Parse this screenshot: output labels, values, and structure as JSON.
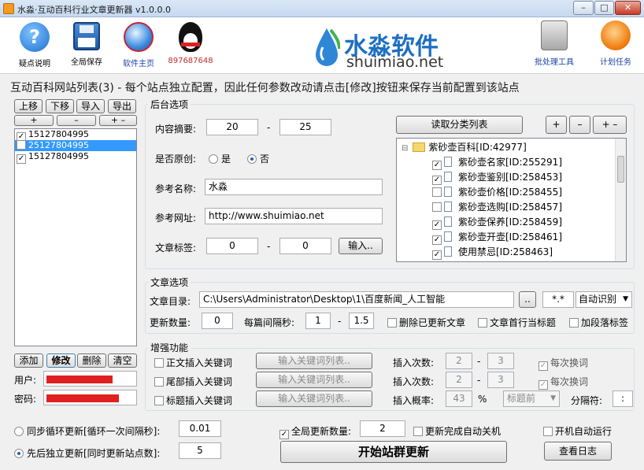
{
  "window": {
    "title": "水淼·互动百科行业文章更新器 v1.0.0.0",
    "min": "–",
    "max": "□",
    "close": "✕"
  },
  "toolbar": {
    "help": "疑点说明",
    "save": "全局保存",
    "homepage": "软件主页",
    "qq": "897687648",
    "batch": "批处理工具",
    "schedule": "计划任务"
  },
  "logo": {
    "name": "水淼软件",
    "domain": "shuimiao.net"
  },
  "headline": "互动百科网站列表(3) - 每个站点独立配置，因此任何参数改动请点击[修改]按钮来保存当前配置到该站点",
  "sitelist": {
    "up": "上移",
    "down": "下移",
    "import": "导入",
    "export": "导出",
    "plus": "+",
    "minus": "–",
    "plusminus": "+ –",
    "items": [
      {
        "label": "15127804995",
        "checked": true,
        "selected": false
      },
      {
        "label": "25127804995",
        "checked": false,
        "selected": true
      },
      {
        "label": "15127804995",
        "checked": true,
        "selected": false
      }
    ],
    "add": "添加",
    "modify": "修改",
    "delete": "删除",
    "clear": "清空",
    "user_label": "用户:",
    "pass_label": "密码:"
  },
  "backend": {
    "title": "后台选项",
    "summary_label": "内容摘要:",
    "summary_min": "20",
    "summary_dash": "-",
    "summary_max": "25",
    "original_label": "是否原创:",
    "yes": "是",
    "no": "否",
    "ref_name_label": "参考名称:",
    "ref_name": "水淼",
    "ref_url_label": "参考网址:",
    "ref_url": "http://www.shuimiao.net",
    "tag_label": "文章标签:",
    "tag_min": "0",
    "tag_dash": "-",
    "tag_max": "0",
    "input_btn": "输入.."
  },
  "category": {
    "read_btn": "读取分类列表",
    "plus": "+",
    "minus": "–",
    "plusminus": "+ –",
    "root": {
      "label": "紫砂壶百科[ID:42977]",
      "toggle": "⊟"
    },
    "children": [
      {
        "label": "紫砂壶名家[ID:255291]",
        "checked": true
      },
      {
        "label": "紫砂壶鉴别[ID:258453]",
        "checked": true
      },
      {
        "label": "紫砂壶价格[ID:258455]",
        "checked": false
      },
      {
        "label": "紫砂壶选购[ID:258457]",
        "checked": false
      },
      {
        "label": "紫砂壶保养[ID:258459]",
        "checked": true
      },
      {
        "label": "紫砂壶开壶[ID:258461]",
        "checked": true
      },
      {
        "label": "使用禁忌[ID:258463]",
        "checked": true
      }
    ]
  },
  "article": {
    "title": "文章选项",
    "dir_label": "文章目录:",
    "dir": "C:\\Users\\Administrator\\Desktop\\1\\百度新闻_人工智能",
    "browse": "..",
    "ext": "*.*",
    "encoding": "自动识别",
    "count_label": "更新数量:",
    "count": "0",
    "interval_label": "每篇间隔秒:",
    "interval_min": "1",
    "interval_dash": "-",
    "interval_max": "1.5",
    "delete_updated": "删除已更新文章",
    "first_line_title": "文章首行当标题",
    "add_para_tag": "加段落标签"
  },
  "enhance": {
    "title": "增强功能",
    "rows": [
      {
        "label": "正文插入关键词",
        "btn": "输入关键词列表..",
        "times_label": "插入次数:",
        "min": "2",
        "dash": "-",
        "max": "3",
        "each": "每次换词"
      },
      {
        "label": "尾部插入关键词",
        "btn": "输入关键词列表..",
        "times_label": "插入次数:",
        "min": "2",
        "dash": "-",
        "max": "3",
        "each": "每次换词"
      },
      {
        "label": "标题插入关键词",
        "btn": "输入关键词列表..",
        "prob_label": "插入概率:",
        "prob": "43",
        "pct": "%",
        "pos": "标题前",
        "sep_label": "分隔符:",
        "sep": ":"
      }
    ]
  },
  "bottom": {
    "sync_label": "同步循环更新[循环一次间隔秒]:",
    "sync_val": "0.01",
    "seq_label": "先后独立更新[同时更新站点数]:",
    "seq_val": "5",
    "global_count_label": "全局更新数量:",
    "global_count": "2",
    "shutdown": "更新完成自动关机",
    "autostart": "开机自动运行",
    "start": "开始站群更新",
    "log": "查看日志"
  }
}
